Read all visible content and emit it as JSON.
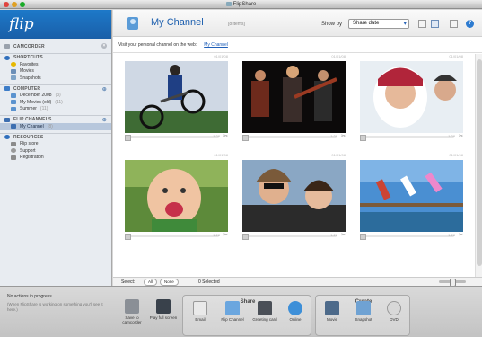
{
  "window": {
    "title": "FlipShare"
  },
  "sidebar": {
    "logo": "flip",
    "sections": [
      {
        "id": "camcorder",
        "label": "CAMCORDER",
        "items": []
      },
      {
        "id": "shortcuts",
        "label": "SHORTCUTS",
        "items": [
          {
            "label": "Favorites",
            "icon": "star-icon"
          },
          {
            "label": "Movies",
            "icon": "movie-icon"
          },
          {
            "label": "Snapshots",
            "icon": "snapshot-icon"
          }
        ]
      },
      {
        "id": "computer",
        "label": "COMPUTER",
        "items": [
          {
            "label": "December 2008",
            "count": "(3)",
            "icon": "folder-icon"
          },
          {
            "label": "My Movies (old)",
            "count": "(11)",
            "icon": "folder-icon"
          },
          {
            "label": "Summer",
            "count": "(11)",
            "icon": "folder-icon"
          }
        ]
      },
      {
        "id": "flip_channels",
        "label": "FLIP CHANNELS",
        "items": [
          {
            "label": "My Channel",
            "count": "(8)",
            "icon": "channel-icon",
            "selected": true
          }
        ]
      },
      {
        "id": "resources",
        "label": "RESOURCES",
        "items": [
          {
            "label": "Flip store",
            "icon": "cart-icon"
          },
          {
            "label": "Support",
            "icon": "support-icon"
          },
          {
            "label": "Registration",
            "icon": "registration-icon"
          }
        ]
      }
    ]
  },
  "main": {
    "title": "My Channel",
    "count": "[8 items]",
    "show_by_label": "Show by",
    "show_by_value": "Share date",
    "help": "?",
    "visit_text": "Visit your personal channel on the web:",
    "visit_link": "My Channel",
    "thumbs": [
      {
        "date": "01/01/08",
        "time": "1:28"
      },
      {
        "date": "01/01/08",
        "time": "1:28"
      },
      {
        "date": "01/01/08",
        "time": "1:28"
      },
      {
        "date": "01/01/08",
        "time": "1:28"
      },
      {
        "date": "01/01/08",
        "time": "1:28"
      },
      {
        "date": "01/01/08",
        "time": "1:28"
      }
    ],
    "select_label": "Select:",
    "select_all": "All",
    "select_none": "None",
    "selected_count": "0 Selected"
  },
  "toolbar": {
    "status": "No actions in progress.",
    "status_sub": "(When FlipShare is working on something you'll see it here.)",
    "save_label": "Save to camcorder",
    "fullscreen_label": "Play full screen",
    "share_title": "Share",
    "share_items": [
      "Email",
      "Flip Channel",
      "Greeting card",
      "Online"
    ],
    "create_title": "Create",
    "create_items": [
      "Movie",
      "Snapshot",
      "DVD"
    ]
  }
}
